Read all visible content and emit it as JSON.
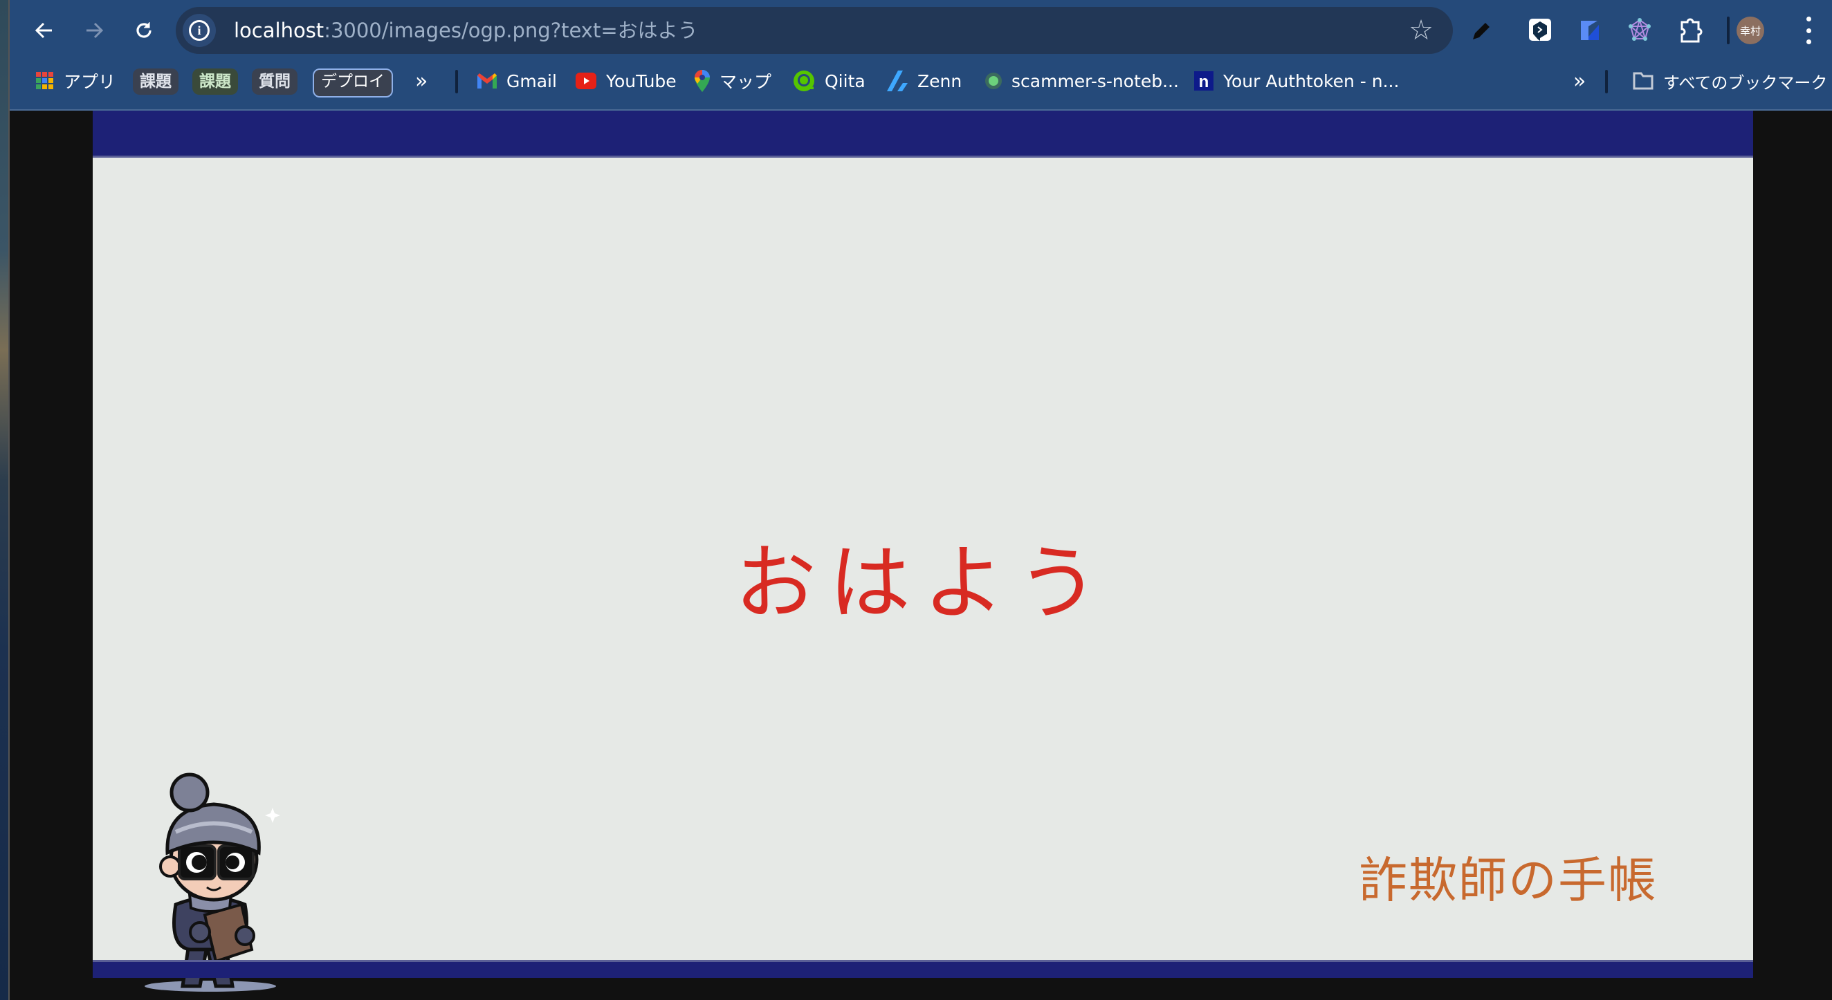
{
  "browser": {
    "url_host": "localhost",
    "url_rest": ":3000/images/ogp.png?text=おはよう",
    "profile_initials": "幸村",
    "nav": {
      "back": "←",
      "forward": "→",
      "reload": "↻"
    },
    "toolbar_icons": [
      "pencil-icon",
      "deepl-icon",
      "extension-blue-icon",
      "network-graph-icon",
      "puzzle-extensions-icon"
    ],
    "bookmarks_bar": {
      "apps_label": "アプリ",
      "chips": [
        {
          "label": "課題",
          "style": "dark"
        },
        {
          "label": "課題",
          "style": "green"
        },
        {
          "label": "質問",
          "style": "dark"
        },
        {
          "label": "デプロイ",
          "style": "outlined"
        }
      ],
      "overflow_left": "»",
      "items": [
        {
          "label": "Gmail",
          "icon": "gmail-icon"
        },
        {
          "label": "YouTube",
          "icon": "youtube-icon"
        },
        {
          "label": "マップ",
          "icon": "maps-icon"
        },
        {
          "label": "Qiita",
          "icon": "qiita-icon"
        },
        {
          "label": "Zenn",
          "icon": "zenn-icon"
        },
        {
          "label": "scammer-s-noteb...",
          "icon": "green-dot-icon"
        },
        {
          "label": "Your Authtoken - n...",
          "icon": "ngrok-n-icon"
        }
      ],
      "overflow_right": "»",
      "all_bookmarks": "すべてのブックマーク"
    }
  },
  "page": {
    "greeting_text": "おはよう",
    "brand_text": "詐欺師の手帳",
    "colors": {
      "band": "#1d2176",
      "background": "#e6e9e6",
      "greeting": "#d82a22",
      "brand": "#c8692e"
    },
    "mascot": "thief character in beanie and glasses holding notebook"
  }
}
